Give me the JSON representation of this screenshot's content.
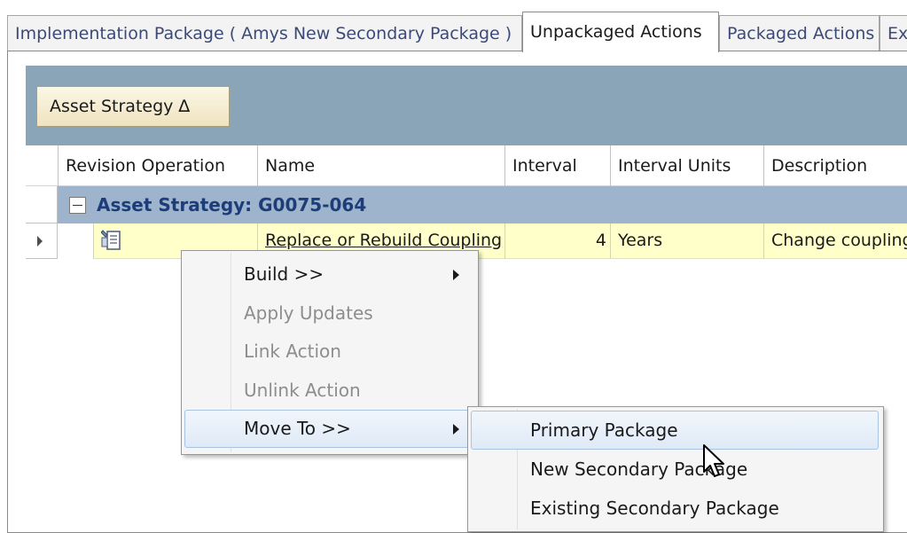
{
  "tabs": [
    {
      "label": "Implementation Package ( Amys New Secondary Package )",
      "active": false
    },
    {
      "label": "Unpackaged Actions",
      "active": true
    },
    {
      "label": "Packaged Actions",
      "active": false
    },
    {
      "label": "Ex",
      "active": false
    }
  ],
  "group_by_button": {
    "label": "Asset Strategy ∆"
  },
  "grid": {
    "columns": [
      "Revision Operation",
      "Name",
      "Interval",
      "Interval Units",
      "Description"
    ],
    "group_row": {
      "label": "Asset Strategy: G0075-064"
    },
    "rows": [
      {
        "revision_operation_icon": "document-edit-icon",
        "name": "Replace or Rebuild Coupling",
        "interval": "4",
        "interval_units": "Years",
        "description": "Change coupling"
      }
    ]
  },
  "context_menu": {
    "items": [
      {
        "label": "Build >>",
        "enabled": true,
        "has_submenu": true
      },
      {
        "label": "Apply Updates",
        "enabled": false,
        "has_submenu": false
      },
      {
        "label": "Link Action",
        "enabled": false,
        "has_submenu": false
      },
      {
        "label": "Unlink Action",
        "enabled": false,
        "has_submenu": false
      },
      {
        "label": "Move To >>",
        "enabled": true,
        "has_submenu": true,
        "highlighted": true
      }
    ]
  },
  "move_to_submenu": {
    "items": [
      {
        "label": "Primary Package",
        "highlighted": true
      },
      {
        "label": "New Secondary Package",
        "highlighted": false
      },
      {
        "label": "Existing Secondary Package",
        "highlighted": false
      }
    ]
  },
  "colors": {
    "group_bar": "#8aa4b8",
    "group_row": "#9db4cc",
    "row_highlight": "#ffffc9",
    "group_title": "#1d3c7a",
    "menu_hover": "#dfeaf7"
  }
}
